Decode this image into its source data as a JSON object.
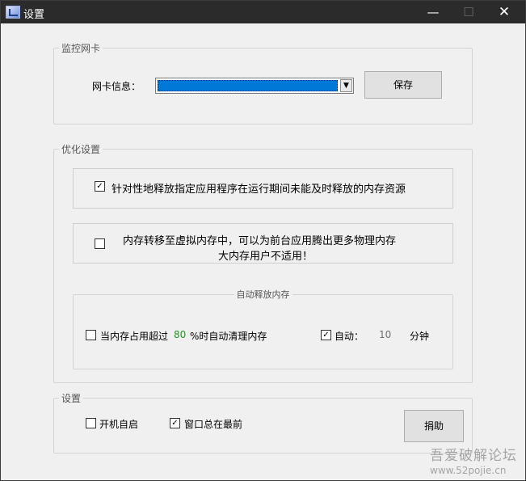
{
  "window": {
    "title": "设置"
  },
  "nic": {
    "legend": "监控网卡",
    "label": "网卡信息：",
    "save": "保存"
  },
  "optimize": {
    "legend": "优化设置",
    "opt1": "针对性地释放指定应用程序在运行期间未能及时释放的内存资源",
    "opt2_line1": "内存转移至虚拟内存中，可以为前台应用腾出更多物理内存",
    "opt2_line2": "大内存用户不适用！",
    "auto": {
      "legend": "自动释放内存",
      "prefix": "当内存占用超过",
      "percent": "80",
      "suffix": "%时自动清理内存",
      "auto_label": "自动：",
      "minutes": "10",
      "unit": "分钟"
    }
  },
  "settings": {
    "legend": "设置",
    "startup": "开机自启",
    "topmost": "窗口总在最前",
    "donate": "捐助"
  },
  "watermark": {
    "line1": "吾爱破解论坛",
    "line2": "www.52pojie.cn"
  },
  "checks": {
    "opt1": true,
    "opt2": false,
    "percent": false,
    "auto": true,
    "startup": false,
    "topmost": true
  }
}
